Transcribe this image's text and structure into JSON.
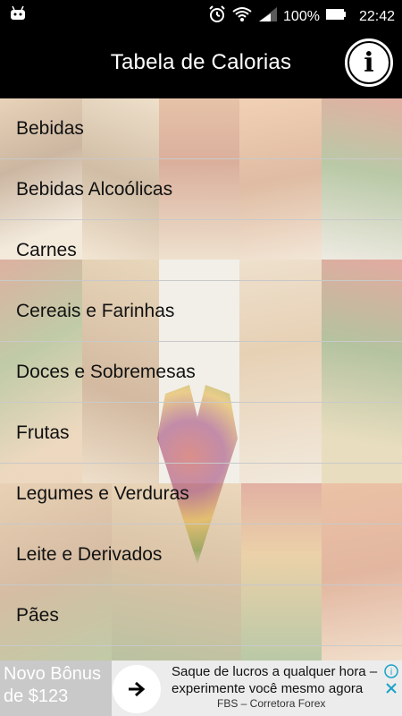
{
  "status_bar": {
    "battery": "100%",
    "time": "22:42",
    "icons": [
      "android-notification-icon",
      "alarm-icon",
      "wifi-icon",
      "signal-icon",
      "battery-icon"
    ]
  },
  "header": {
    "title": "Tabela de Calorias",
    "info_icon": "info-icon",
    "info_glyph": "i"
  },
  "categories": [
    "Bebidas",
    "Bebidas Alcoólicas",
    "Carnes",
    "Cereais e Farinhas",
    "Doces e Sobremesas",
    "Frutas",
    "Legumes e Verduras",
    "Leite e Derivados",
    "Pães"
  ],
  "ad": {
    "left_text": "Novo Bônus de $123",
    "main_text": "Saque de lucros a qualquer hora – experimente você mesmo agora",
    "sponsor": "FBS – Corretora Forex",
    "arrow_icon": "arrow-right-icon"
  },
  "colors": {
    "header_bg": "#000000",
    "text": "#111111",
    "divider": "#c9c9c9",
    "ad_bg": "#ececec"
  }
}
